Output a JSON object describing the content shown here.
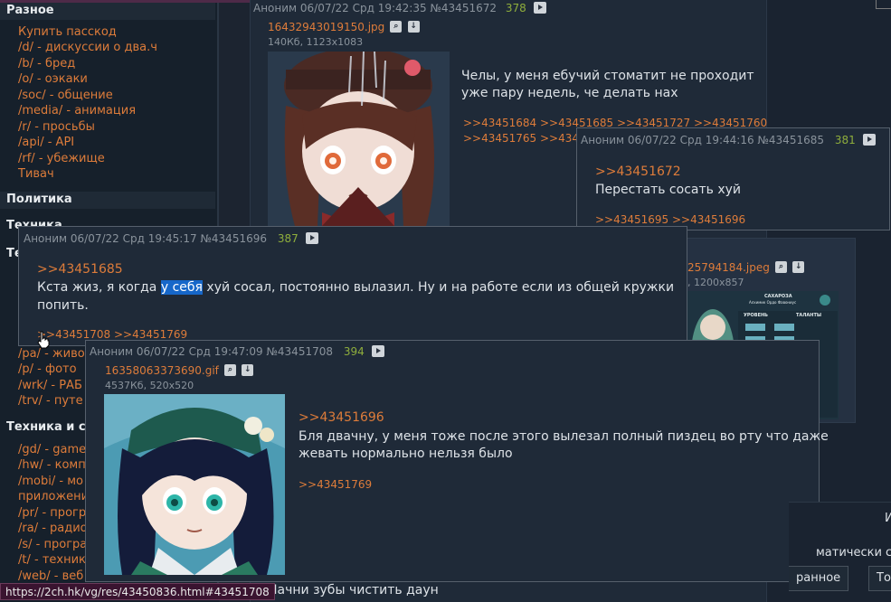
{
  "sidebar": {
    "cat_misc": "Разное",
    "misc_items": [
      {
        "text": "Купить пасскод"
      },
      {
        "text": "/d/ - дискуссии о два.ч"
      },
      {
        "text": "/b/ - бред"
      },
      {
        "text": "/o/ - оэкаки"
      },
      {
        "text": "/soc/ - общение"
      },
      {
        "text": "/media/ - анимация"
      },
      {
        "text": "/r/ - просьбы"
      },
      {
        "text": "/api/ - API"
      },
      {
        "text": "/rf/ - убежище"
      },
      {
        "text": "Тивач"
      }
    ],
    "cat_politics": "Политика",
    "cat_tech_cut": "Техника",
    "cat_te_cut": "Те",
    "mid_items": [
      {
        "text": "/pa/ - живо"
      },
      {
        "text": "/p/ - фото"
      },
      {
        "text": "/wrk/ - РАБ"
      },
      {
        "text": "/trv/ - путе"
      }
    ],
    "cat_tech_soft": "Техника и соф",
    "tech_items": [
      {
        "text": "/gd/ - game"
      },
      {
        "text": "/hw/ - комп"
      },
      {
        "text": "/mobi/ - мо"
      },
      {
        "text": "приложения"
      },
      {
        "text": "/pr/ - прогр"
      },
      {
        "text": "/ra/ - радио"
      },
      {
        "text": "/s/ - програ"
      },
      {
        "text": "/t/ - техник"
      },
      {
        "text": "/web/ - веб"
      }
    ]
  },
  "op_post": {
    "meta": "Аноним 06/07/22 Срд 19:42:35 №43451672",
    "num": "378",
    "file_name": "16432943019150.jpg",
    "file_info": "140Кб, 1123x1083",
    "text_line1": "Челы, у меня ебучий стоматит не проходит",
    "text_line2": "уже пару недель, че делать нах",
    "replies_line1": ">>43451684 >>43451685 >>43451727 >>43451760",
    "replies_line2": ">>43451765 >>4345177"
  },
  "bg_post2": {
    "file_name": "25794184.jpeg",
    "file_info": ", 1200x857",
    "image_title": "САХАРОЗА",
    "image_sub": "Алхимик Ордо Фавониус",
    "image_col1": "УРОВЕНЬ",
    "image_col2": "ТАЛАНТЫ"
  },
  "popup_1685": {
    "meta": "Аноним 06/07/22 Срд 19:44:16 №43451685",
    "num": "381",
    "reply_to": ">>43451672",
    "text": "Перестать сосать хуй",
    "replies": ">>43451695 >>43451696"
  },
  "popup_1696": {
    "meta": "Аноним 06/07/22 Срд 19:45:17 №43451696",
    "num": "387",
    "reply_to": ">>43451685",
    "text_before": "Кста жиз, я когда ",
    "text_highlight": "у себя",
    "text_after": " хуй сосал, постоянно вылазил. Ну и на работе если из общей кружки",
    "text_line2": "попить.",
    "replies": ">>43451708 >>43451769"
  },
  "popup_1708": {
    "meta": "Аноним 06/07/22 Срд 19:47:09 №43451708",
    "num": "394",
    "file_name": "16358063373690.gif",
    "file_info": "4537Кб, 520x520",
    "reply_to": ">>43451696",
    "text_line1": "Бля двачну, у меня тоже после этого вылезал полный пиздец во рту что даже",
    "text_line2": "жевать нормально нельзя было",
    "replies": ">>43451769"
  },
  "right_panel": {
    "text_top": "И",
    "text_auto": "матически сл",
    "btn_fav": "ранное",
    "btn_to": "То"
  },
  "bottom_text": "Начни зубы чистить даун",
  "status_url": "https://2ch.hk/vg/res/43450836.html#43451708"
}
